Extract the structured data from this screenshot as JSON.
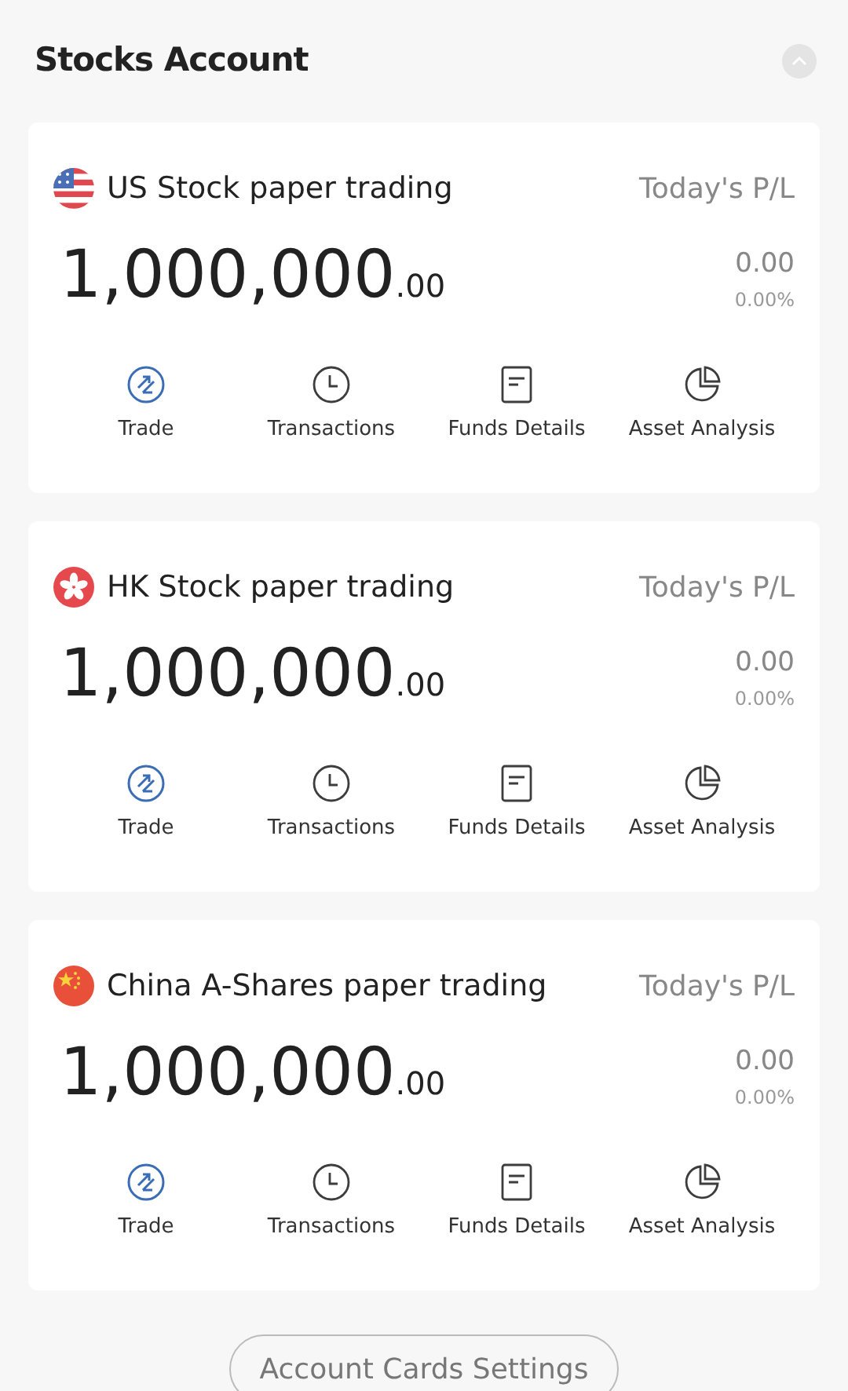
{
  "header": {
    "title": "Stocks Account"
  },
  "accounts": [
    {
      "kind": "us",
      "name": "US Stock paper trading",
      "pl_label": "Today's P/L",
      "balance_int": "1,000,000",
      "balance_dec": ".00",
      "pl_value": "0.00",
      "pl_percent": "0.00%",
      "actions": [
        {
          "kind": "trade",
          "label": "Trade"
        },
        {
          "kind": "clock",
          "label": "Transactions"
        },
        {
          "kind": "doc",
          "label": "Funds Details"
        },
        {
          "kind": "pie",
          "label": "Asset Analysis"
        }
      ]
    },
    {
      "kind": "hk",
      "name": "HK Stock paper trading",
      "pl_label": "Today's P/L",
      "balance_int": "1,000,000",
      "balance_dec": ".00",
      "pl_value": "0.00",
      "pl_percent": "0.00%",
      "actions": [
        {
          "kind": "trade",
          "label": "Trade"
        },
        {
          "kind": "clock",
          "label": "Transactions"
        },
        {
          "kind": "doc",
          "label": "Funds Details"
        },
        {
          "kind": "pie",
          "label": "Asset Analysis"
        }
      ]
    },
    {
      "kind": "cn",
      "name": "China A-Shares paper trading",
      "pl_label": "Today's P/L",
      "balance_int": "1,000,000",
      "balance_dec": ".00",
      "pl_value": "0.00",
      "pl_percent": "0.00%",
      "actions": [
        {
          "kind": "trade",
          "label": "Trade"
        },
        {
          "kind": "clock",
          "label": "Transactions"
        },
        {
          "kind": "doc",
          "label": "Funds Details"
        },
        {
          "kind": "pie",
          "label": "Asset Analysis"
        }
      ]
    }
  ],
  "settings_button": "Account Cards Settings"
}
